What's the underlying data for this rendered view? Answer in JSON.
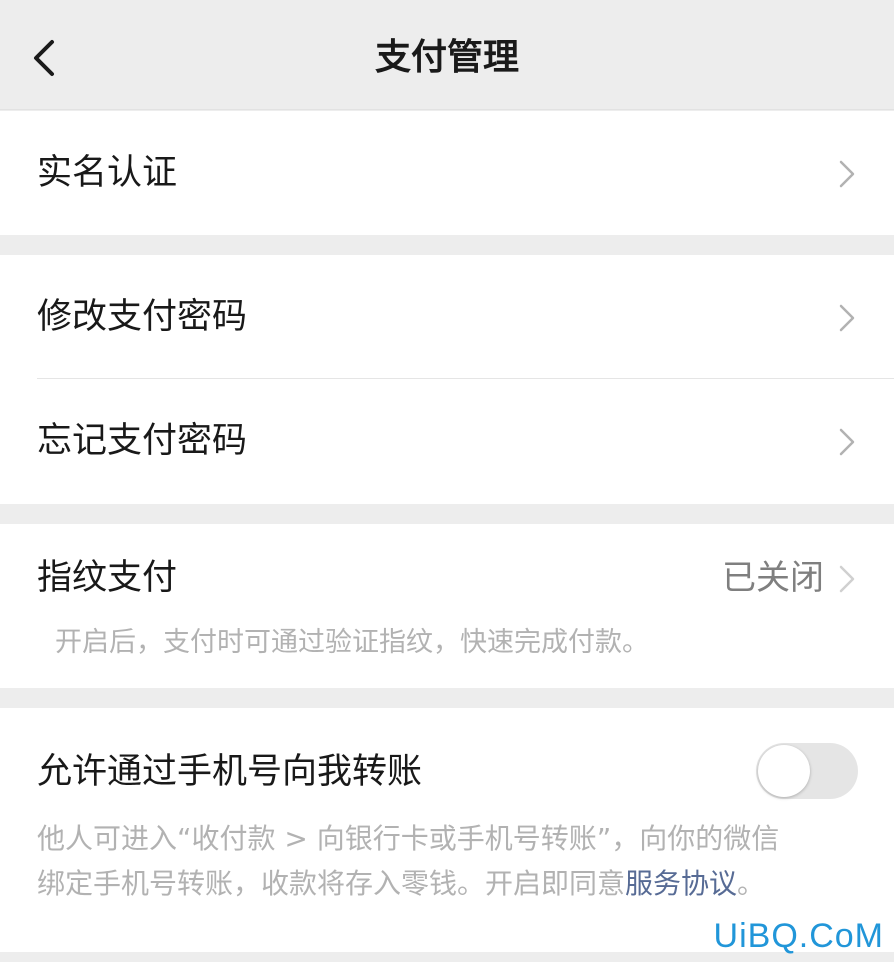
{
  "nav": {
    "title": "支付管理",
    "back_icon": "chevron-left-icon"
  },
  "groups": {
    "real_name": {
      "label": "实名认证",
      "chevron": "chevron-right-icon"
    },
    "password": {
      "modify_label": "修改支付密码",
      "forgot_label": "忘记支付密码"
    },
    "fingerprint": {
      "label": "指纹支付",
      "status": "已关闭",
      "description": "开启后，支付时可通过验证指纹，快速完成付款。"
    },
    "phone_transfer": {
      "label": "允许通过手机号向我转账",
      "enabled": false,
      "description_line1": "他人可进入“收付款 > 向银行卡或手机号转账”，向你的微信",
      "description_line2": "绑定手机号转账，收款将存入零钱。开启即同意",
      "agreement_link": "服务协议",
      "description_end": "。"
    }
  },
  "colors": {
    "background": "#ededed",
    "card": "#ffffff",
    "primary_text": "#191919",
    "secondary_text": "#b2b2b2",
    "link": "#576b95",
    "watermark": "#2196d9"
  },
  "watermark": "UiBQ.CoM"
}
